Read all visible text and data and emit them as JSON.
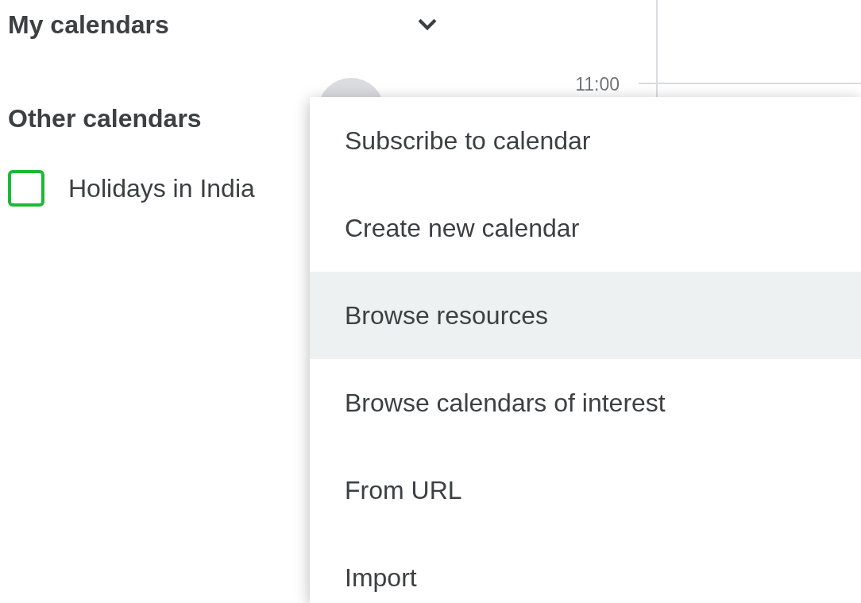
{
  "sidebar": {
    "sections": [
      {
        "title": "My calendars",
        "expanded": true
      },
      {
        "title": "Other calendars",
        "calendars": [
          {
            "name": "Holidays in India",
            "checked": false,
            "color": "#1bb934"
          }
        ]
      }
    ]
  },
  "grid": {
    "time_label": "11:00"
  },
  "menu": {
    "items": [
      {
        "label": "Subscribe to calendar",
        "selected": false
      },
      {
        "label": "Create new calendar",
        "selected": false
      },
      {
        "label": "Browse resources",
        "selected": true
      },
      {
        "label": "Browse calendars of interest",
        "selected": false
      },
      {
        "label": "From URL",
        "selected": false
      },
      {
        "label": "Import",
        "selected": false
      }
    ]
  }
}
